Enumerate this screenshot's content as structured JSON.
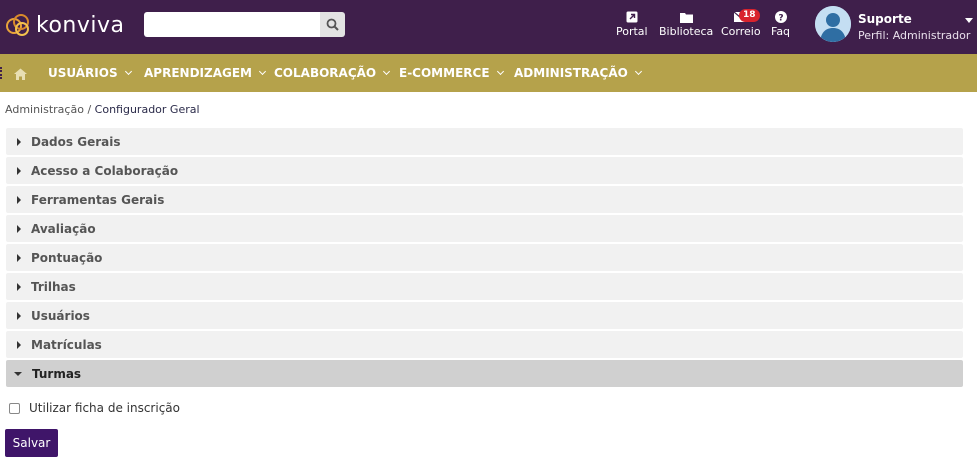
{
  "header": {
    "logo_text": "konviva",
    "search": {
      "placeholder": "",
      "value": ""
    },
    "tools": [
      {
        "icon": "external-link-icon",
        "label": "Portal"
      },
      {
        "icon": "folder-icon",
        "label": "Biblioteca"
      },
      {
        "icon": "mail-icon",
        "label": "Correio",
        "badge": "18"
      },
      {
        "icon": "question-icon",
        "label": "Faq"
      }
    ],
    "user": {
      "name": "Suporte",
      "role": "Perfil: Administrador"
    }
  },
  "nav": {
    "items": [
      {
        "label": "USUÁRIOS"
      },
      {
        "label": "APRENDIZAGEM"
      },
      {
        "label": "COLABORAÇÃO"
      },
      {
        "label": "E-COMMERCE"
      },
      {
        "label": "ADMINISTRAÇÃO"
      }
    ]
  },
  "breadcrumb": {
    "parent": "Administração",
    "separator": "/",
    "current": "Configurador Geral"
  },
  "sections": [
    {
      "label": "Dados Gerais",
      "expanded": false
    },
    {
      "label": "Acesso a Colaboração",
      "expanded": false
    },
    {
      "label": "Ferramentas Gerais",
      "expanded": false
    },
    {
      "label": "Avaliação",
      "expanded": false
    },
    {
      "label": "Pontuação",
      "expanded": false
    },
    {
      "label": "Trilhas",
      "expanded": false
    },
    {
      "label": "Usuários",
      "expanded": false
    },
    {
      "label": "Matrículas",
      "expanded": false
    },
    {
      "label": "Turmas",
      "expanded": true
    }
  ],
  "form": {
    "checkbox_label": "Utilizar ficha de inscrição",
    "checkbox_checked": false,
    "save_label": "Salvar"
  },
  "colors": {
    "topbar": "#3f1f4b",
    "navbar": "#b5a24b",
    "save_button": "#3f1569",
    "badge": "#d9232d"
  }
}
